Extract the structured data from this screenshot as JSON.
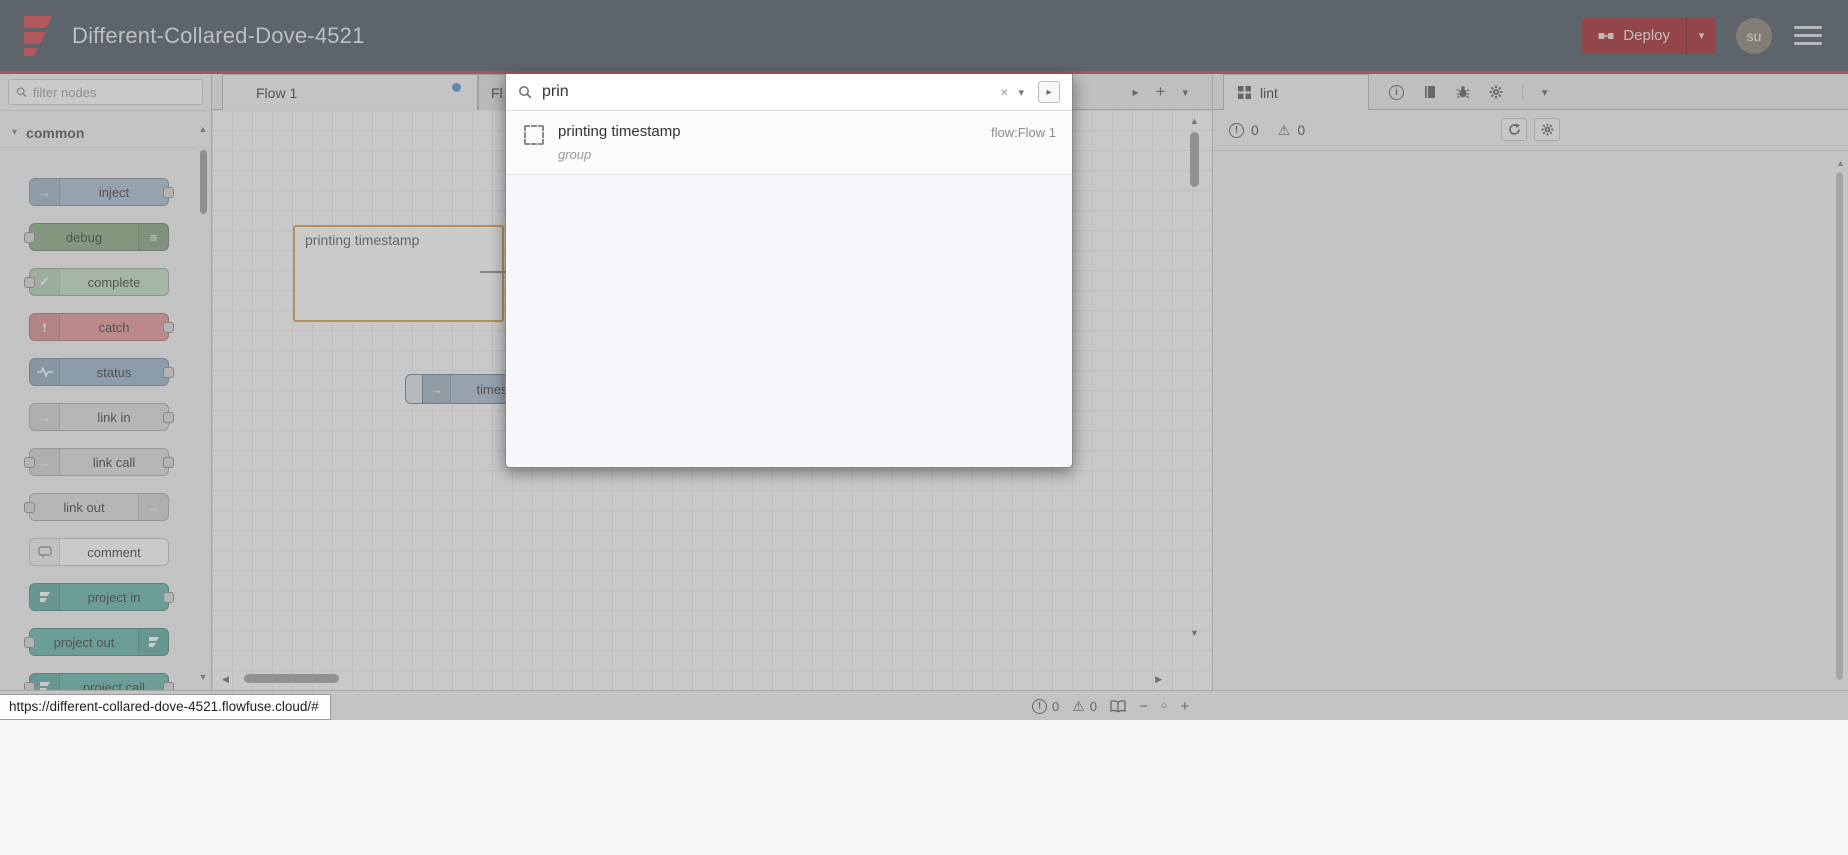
{
  "header": {
    "title": "Different-Collared-Dove-4521",
    "deploy": {
      "label": "Deploy"
    },
    "avatar_text": "su"
  },
  "colors": {
    "header_bg": "#44505c",
    "accent_red": "#c0393d",
    "deploy_bg": "#a01c24",
    "tab_dirty_dot": "#3f97d3",
    "group_border": "#dd9a43",
    "canvas_grid": "#ececec"
  },
  "palette": {
    "filter_placeholder": "filter nodes",
    "category_label": "common",
    "nodes": [
      {
        "label": "inject",
        "color": "#a6bbcf",
        "icon": "→"
      },
      {
        "label": "debug",
        "color": "#87a980",
        "icon": "≡"
      },
      {
        "label": "complete",
        "color": "#c0dcc0",
        "icon": "✓"
      },
      {
        "label": "catch",
        "color": "#e49191",
        "icon": "!"
      },
      {
        "label": "status",
        "color": "#94b0c8"
      },
      {
        "label": "link in",
        "color": "#dddddd",
        "icon": "→"
      },
      {
        "label": "link call",
        "color": "#dddddd",
        "icon": "→"
      },
      {
        "label": "link out",
        "color": "#dddddd",
        "icon": "→"
      },
      {
        "label": "comment",
        "color": "#ffffff"
      },
      {
        "label": "project in",
        "color": "#5db3a9"
      },
      {
        "label": "project out",
        "color": "#5db3a9"
      },
      {
        "label": "project call",
        "color": "#5db3a9"
      }
    ]
  },
  "workspace": {
    "tabs": [
      {
        "label": "Flow 1",
        "dirty": true
      },
      {
        "label": "Fl"
      }
    ],
    "group_label": "printing timestamp",
    "node_label": "timestamp"
  },
  "search": {
    "query": "prin",
    "result": {
      "title": "printing timestamp",
      "subtitle": "group",
      "flow_label": "flow:Flow 1"
    }
  },
  "sidebar": {
    "tab_label": "lint",
    "error_count": "0",
    "warning_count": "0"
  },
  "footer": {
    "error_count": "0",
    "warning_count": "0"
  },
  "statusbar": {
    "url": "https://different-collared-dove-4521.flowfuse.cloud/#"
  },
  "icons": {
    "caret_down": "▾",
    "caret_right": "▸",
    "plus": "+",
    "close": "×",
    "minus": "−",
    "zoom_reset": "○",
    "scroll_up": "▲",
    "scroll_down": "▼",
    "scroll_left": "◀",
    "scroll_right": "▶",
    "warning": "⚠",
    "alert": "!",
    "info": "i"
  }
}
